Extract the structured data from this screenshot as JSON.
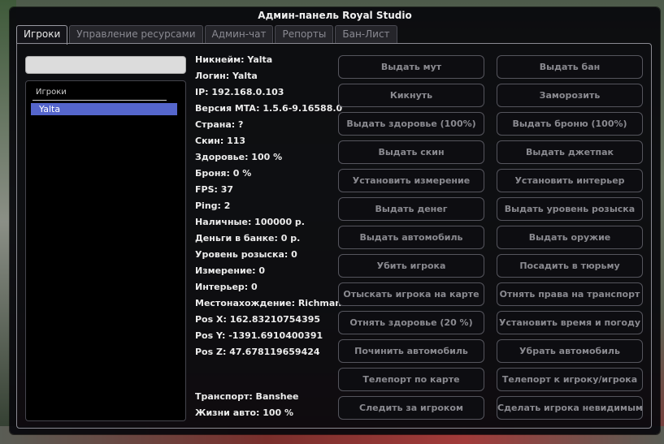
{
  "window": {
    "title": "Админ-панель Royal Studio"
  },
  "tabs": [
    {
      "label": "Игроки",
      "active": true
    },
    {
      "label": "Управление ресурсами",
      "active": false
    },
    {
      "label": "Админ-чат",
      "active": false
    },
    {
      "label": "Репорты",
      "active": false
    },
    {
      "label": "Бан-Лист",
      "active": false
    }
  ],
  "search": {
    "value": "",
    "placeholder": ""
  },
  "player_list": {
    "header": "Игроки",
    "items": [
      "Yalta"
    ],
    "selected": "Yalta"
  },
  "info": {
    "lines": [
      "Никнейм: Yalta",
      "Логин: Yalta",
      "IP: 192.168.0.103",
      "Версия MTA: 1.5.6-9.16588.0",
      "Страна: ?",
      "Скин: 113",
      "Здоровье: 100 %",
      "Броня: 0 %",
      "FPS: 37",
      "Ping: 2",
      "Наличные: 100000 р.",
      "Деньги в банке: 0 р.",
      "Уровень розыска: 0",
      "Измерение: 0",
      "Интерьер: 0",
      "Местонахождение: Richman",
      "Pos X: 162.83210754395",
      "Pos Y: -1391.6910400391",
      "Pos Z: 47.678119659424"
    ],
    "vehicle": "Транспорт: Banshee",
    "vehicle_health": "Жизни авто: 100 %"
  },
  "buttons": {
    "left": [
      "Выдать мут",
      "Кикнуть",
      "Выдать здоровье (100%)",
      "Выдать скин",
      "Установить измерение",
      "Выдать денег",
      "Выдать автомобиль",
      "Убить игрока",
      "Отыскать игрока на карте",
      "Отнять здоровье (20 %)",
      "Починить автомобиль",
      "Телепорт по карте",
      "Следить за игроком"
    ],
    "right": [
      "Выдать бан",
      "Заморозить",
      "Выдать броню (100%)",
      "Выдать джетпак",
      "Установить интерьер",
      "Выдать уровень розыска",
      "Выдать оружие",
      "Посадить в тюрьму",
      "Отнять права на транспорт",
      "Установить время и погоду",
      "Убрать автомобиль",
      "Телепорт к игроку/игрока",
      "Сделать игрока невидимым"
    ]
  }
}
